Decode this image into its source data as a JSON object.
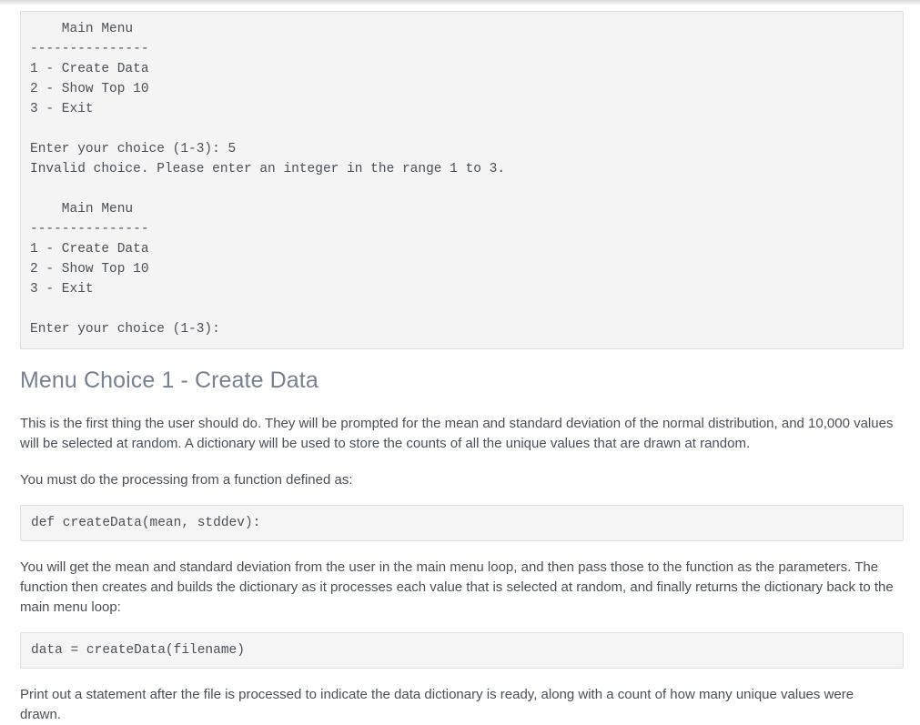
{
  "console": {
    "output": "    Main Menu\n---------------\n1 - Create Data\n2 - Show Top 10\n3 - Exit\n\nEnter your choice (1-3): 5\nInvalid choice. Please enter an integer in the range 1 to 3.\n\n    Main Menu\n---------------\n1 - Create Data\n2 - Show Top 10\n3 - Exit\n\nEnter your choice (1-3): "
  },
  "section": {
    "heading": "Menu Choice 1 - Create Data",
    "paragraph_1": "This is the first thing the user should do. They will be prompted for the mean and standard deviation of the normal distribution, and 10,000 values will be selected at random. A dictionary will be used to store the counts of all the unique values that are drawn at random.",
    "paragraph_2": "You must do the processing from a function defined as:",
    "code_1": "def createData(mean, stddev):",
    "paragraph_3": "You will get the mean and standard deviation from the user in the main menu loop, and then pass those to the function as the parameters. The function then creates and builds the dictionary as it processes each value that is selected at random, and finally returns the dictionary back to the main menu loop:",
    "code_2": "data = createData(filename)",
    "paragraph_4": "Print out a statement after the file is processed to indicate the data dictionary is ready, along with a count of how many unique values were drawn."
  },
  "colors": {
    "heading": "#77818f",
    "body_text": "#4a5058",
    "code_text": "#4b4f58",
    "console_bg": "#f4f4f4",
    "console_border": "#dcdcdc",
    "code_bg": "#f5f5f5",
    "code_border": "#e2e2e2",
    "page_bg": "#ffffff"
  }
}
